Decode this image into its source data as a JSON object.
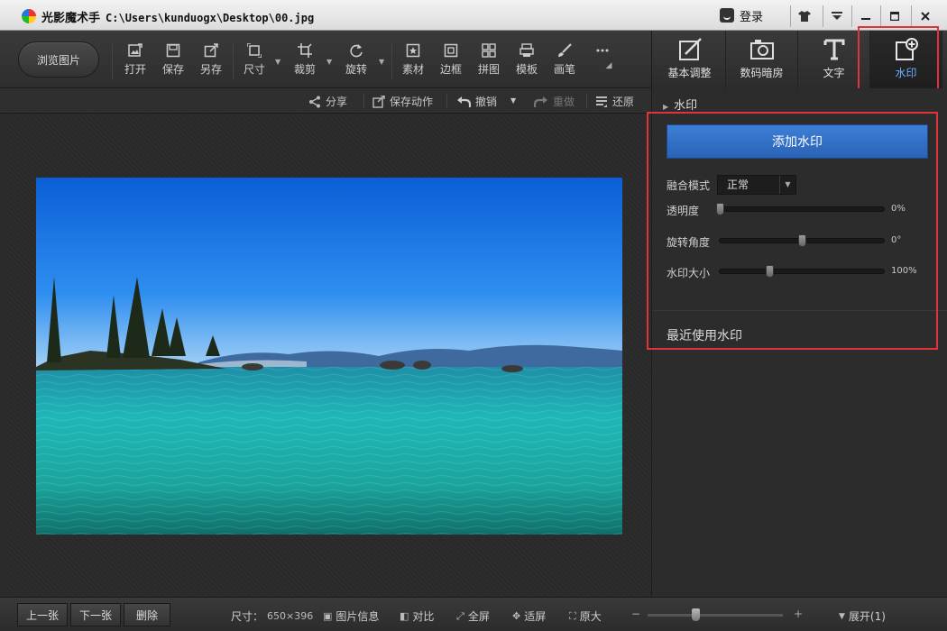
{
  "window": {
    "app_name": "光影魔术手",
    "path": "C:\\Users\\kunduogx\\Desktop\\00.jpg",
    "login_label": "登录",
    "controls": [
      "shirt-icon",
      "dropdown-icon",
      "minimize-icon",
      "maximize-icon",
      "close-icon"
    ]
  },
  "toolbar": {
    "browse_label": "浏览图片",
    "items": [
      {
        "label": "打开",
        "icon": "open-image-icon"
      },
      {
        "label": "保存",
        "icon": "save-icon"
      },
      {
        "label": "另存",
        "icon": "save-as-icon"
      },
      {
        "label": "尺寸",
        "icon": "resize-icon",
        "dropdown": true
      },
      {
        "label": "裁剪",
        "icon": "crop-icon",
        "dropdown": true
      },
      {
        "label": "旋转",
        "icon": "rotate-icon",
        "dropdown": true
      },
      {
        "label": "素材",
        "icon": "material-icon"
      },
      {
        "label": "边框",
        "icon": "border-icon"
      },
      {
        "label": "拼图",
        "icon": "collage-icon"
      },
      {
        "label": "模板",
        "icon": "template-icon"
      },
      {
        "label": "画笔",
        "icon": "brush-icon"
      }
    ],
    "more": "more-icon"
  },
  "category_tabs": [
    {
      "label": "基本调整",
      "icon": "basic-adjust-icon",
      "active": false
    },
    {
      "label": "数码暗房",
      "icon": "darkroom-icon",
      "active": false
    },
    {
      "label": "文字",
      "icon": "text-icon",
      "active": false
    },
    {
      "label": "水印",
      "icon": "watermark-icon",
      "active": true
    }
  ],
  "subbar": {
    "share": "分享",
    "save_action": "保存动作",
    "undo": "撤销",
    "redo": "重做",
    "restore": "还原"
  },
  "panel": {
    "title": "水印",
    "add_button": "添加水印",
    "blend_mode_label": "融合模式",
    "blend_mode_value": "正常",
    "sliders": [
      {
        "label": "透明度",
        "value": "0%",
        "position": 0.0
      },
      {
        "label": "旋转角度",
        "value": "0°",
        "position": 0.5
      },
      {
        "label": "水印大小",
        "value": "100%",
        "position": 0.3
      }
    ],
    "recent_label": "最近使用水印"
  },
  "bottom": {
    "prev": "上一张",
    "next": "下一张",
    "delete": "删除",
    "size_label": "尺寸：",
    "size_value": "650×396",
    "image_info": "图片信息",
    "compare": "对比",
    "fullscreen": "全屏",
    "fit": "适屏",
    "original": "原大",
    "zoom_minus": "−",
    "zoom_plus": "+",
    "zoom_position": 0.35,
    "expand": "展开(1)"
  },
  "colors": {
    "accent_blue": "#3a7ad3",
    "highlight_red": "#e0343c",
    "active_tab_text": "#6fb0ff"
  }
}
